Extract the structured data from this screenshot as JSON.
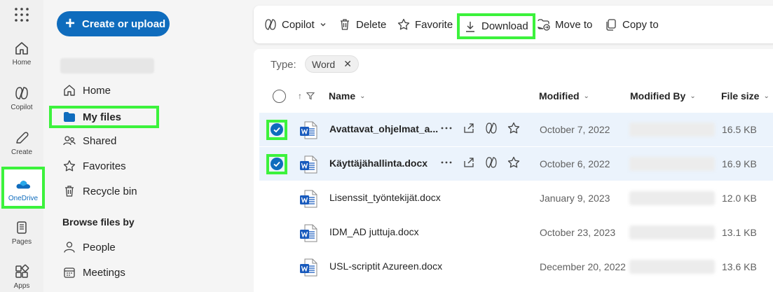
{
  "rail": {
    "items": [
      {
        "label": "Home",
        "icon": "home-icon"
      },
      {
        "label": "Copilot",
        "icon": "copilot-icon"
      },
      {
        "label": "Create",
        "icon": "pen-icon"
      },
      {
        "label": "OneDrive",
        "icon": "onedrive-cloud-icon"
      },
      {
        "label": "Pages",
        "icon": "pages-icon"
      },
      {
        "label": "Apps",
        "icon": "apps-icon"
      }
    ]
  },
  "nav": {
    "create_label": "Create or upload",
    "items": [
      {
        "label": "Home"
      },
      {
        "label": "My files"
      },
      {
        "label": "Shared"
      },
      {
        "label": "Favorites"
      },
      {
        "label": "Recycle bin"
      }
    ],
    "browse_title": "Browse files by",
    "browse_items": [
      {
        "label": "People"
      },
      {
        "label": "Meetings"
      }
    ]
  },
  "toolbar": {
    "copilot": "Copilot",
    "delete": "Delete",
    "favorite": "Favorite",
    "download": "Download",
    "move_to": "Move to",
    "copy_to": "Copy to"
  },
  "filter": {
    "type_label": "Type:",
    "chip": "Word"
  },
  "columns": {
    "name": "Name",
    "modified": "Modified",
    "modified_by": "Modified By",
    "file_size": "File size"
  },
  "files": [
    {
      "name": "Avattavat_ohjelmat_a...",
      "modified": "October 7, 2022",
      "size": "16.5 KB",
      "selected": true
    },
    {
      "name": "Käyttäjähallinta.docx",
      "modified": "October 6, 2022",
      "size": "16.9 KB",
      "selected": true
    },
    {
      "name": "Lisenssit_työntekijät.docx",
      "modified": "January 9, 2023",
      "size": "12.0 KB",
      "selected": false
    },
    {
      "name": "IDM_AD juttuja.docx",
      "modified": "October 23, 2023",
      "size": "13.1 KB",
      "selected": false
    },
    {
      "name": "USL-scriptit Azureen.docx",
      "modified": "December 20, 2022",
      "size": "13.6 KB",
      "selected": false
    }
  ],
  "colors": {
    "accent": "#0f6cbd",
    "highlight": "#3cf23c",
    "selected_row": "#ebf3fc",
    "word_blue": "#185abd"
  }
}
